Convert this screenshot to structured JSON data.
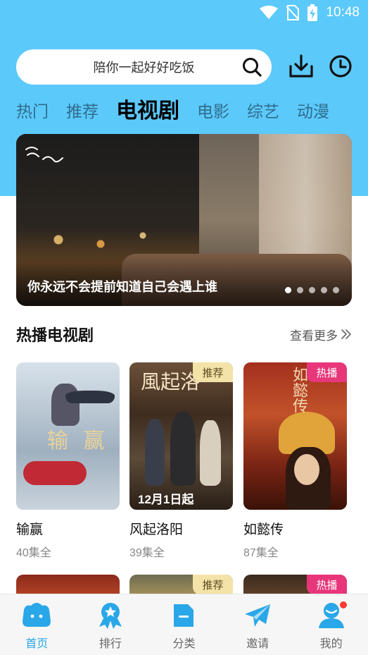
{
  "status_bar": {
    "time": "10:48"
  },
  "search": {
    "text": "陪你一起好好吃饭"
  },
  "tabs": [
    {
      "label": "热门",
      "active": false
    },
    {
      "label": "推荐",
      "active": false
    },
    {
      "label": "电视剧",
      "active": true
    },
    {
      "label": "电影",
      "active": false
    },
    {
      "label": "综艺",
      "active": false
    },
    {
      "label": "动漫",
      "active": false
    }
  ],
  "banner": {
    "caption": "你永远不会提前知道自己会遇上谁",
    "dot_count": 5,
    "active_dot": 0
  },
  "section": {
    "title": "热播电视剧",
    "more_label": "查看更多"
  },
  "cards": [
    {
      "title": "输赢",
      "episodes": "40集全",
      "badge": "",
      "poster_art": "输 赢"
    },
    {
      "title": "风起洛阳",
      "episodes": "39集全",
      "badge": "推荐",
      "poster_art": "風起洛",
      "poster_date": "12月1日起"
    },
    {
      "title": "如懿传",
      "episodes": "87集全",
      "badge": "热播",
      "poster_art": "如懿传"
    }
  ],
  "row2_badges": [
    "",
    "推荐",
    "热播"
  ],
  "bottom_nav": [
    {
      "label": "首页",
      "icon": "home-cloud-icon",
      "active": true
    },
    {
      "label": "排行",
      "icon": "ranking-medal-icon",
      "active": false
    },
    {
      "label": "分类",
      "icon": "category-folder-icon",
      "active": false
    },
    {
      "label": "邀请",
      "icon": "invite-paper-plane-icon",
      "active": false
    },
    {
      "label": "我的",
      "icon": "profile-icon",
      "active": false,
      "has_notification": true
    }
  ],
  "colors": {
    "header_bg": "#5cc9fb",
    "nav_active": "#2aa7e8",
    "badge_hot": "#e8367a",
    "badge_recommend": "#f4e3a8"
  }
}
